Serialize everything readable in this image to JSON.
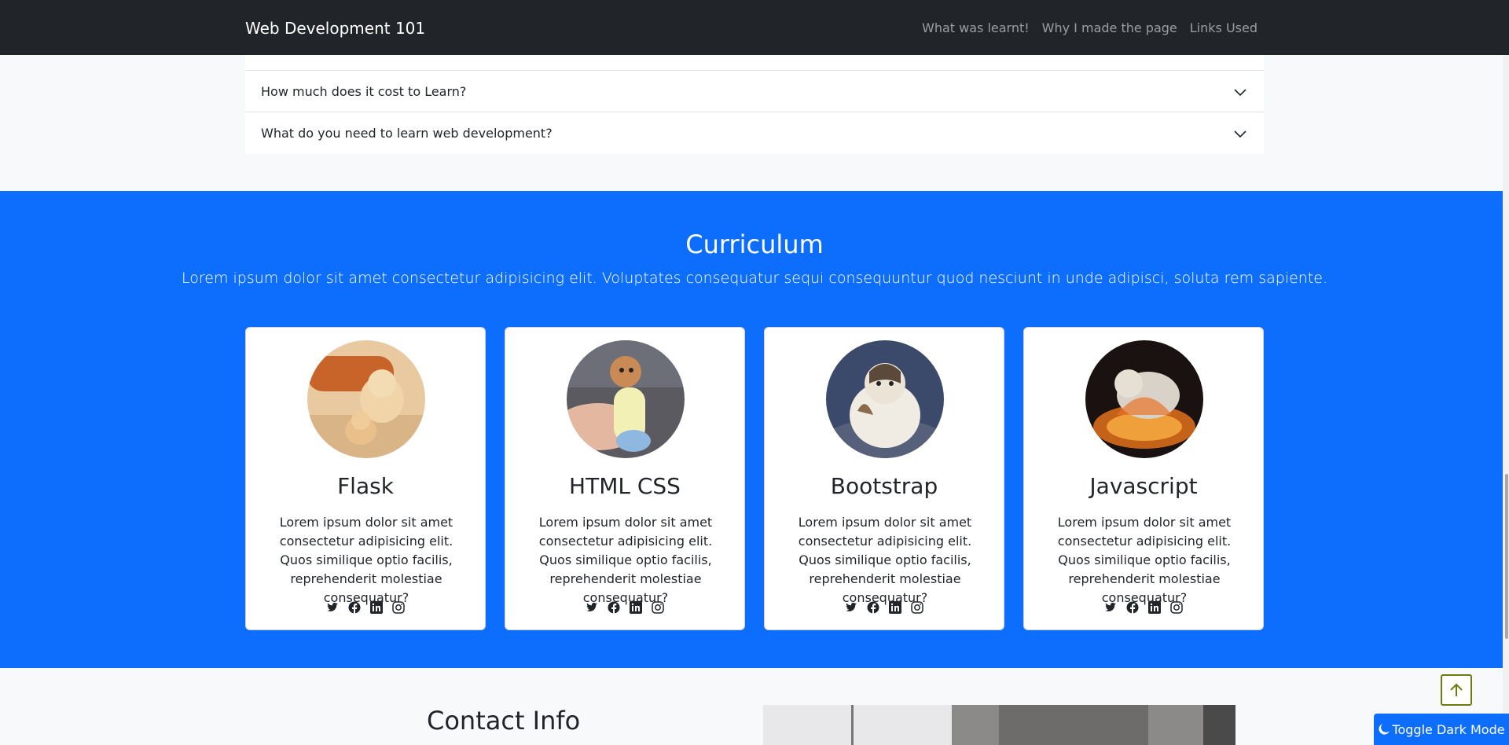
{
  "navbar": {
    "brand": "Web Development 101",
    "links": [
      "What was learnt!",
      "Why I made the page",
      "Links Used"
    ]
  },
  "accordion": {
    "items": [
      "How much does it cost to Learn?",
      "What do you need to learn web development?"
    ]
  },
  "curriculum": {
    "title": "Curriculum",
    "lead": "Lorem ipsum dolor sit amet consectetur adipisicing elit. Voluptates consequatur sequi consequuntur quod nesciunt in unde adipisci, soluta rem sapiente.",
    "cards": [
      {
        "title": "Flask",
        "text": "Lorem ipsum dolor sit amet consectetur adipisicing elit. Quos similique optio facilis, reprehenderit molestiae consequatur?"
      },
      {
        "title": "HTML CSS",
        "text": "Lorem ipsum dolor sit amet consectetur adipisicing elit. Quos similique optio facilis, reprehenderit molestiae consequatur?"
      },
      {
        "title": "Bootstrap",
        "text": "Lorem ipsum dolor sit amet consectetur adipisicing elit. Quos similique optio facilis, reprehenderit molestiae consequatur?"
      },
      {
        "title": "Javascript",
        "text": "Lorem ipsum dolor sit amet consectetur adipisicing elit. Quos similique optio facilis, reprehenderit molestiae consequatur?"
      }
    ],
    "social_icons": [
      "twitter-icon",
      "facebook-icon",
      "linkedin-icon",
      "instagram-icon"
    ]
  },
  "contact": {
    "title": "Contact Info"
  },
  "controls": {
    "back_to_top_icon": "arrow-up-icon",
    "dark_mode_label": "Toggle Dark Mode",
    "dark_mode_icon": "moon-icon"
  },
  "colors": {
    "navbar_bg": "#212529",
    "primary": "#0d6efd",
    "page_bg": "#f8f9fa"
  }
}
